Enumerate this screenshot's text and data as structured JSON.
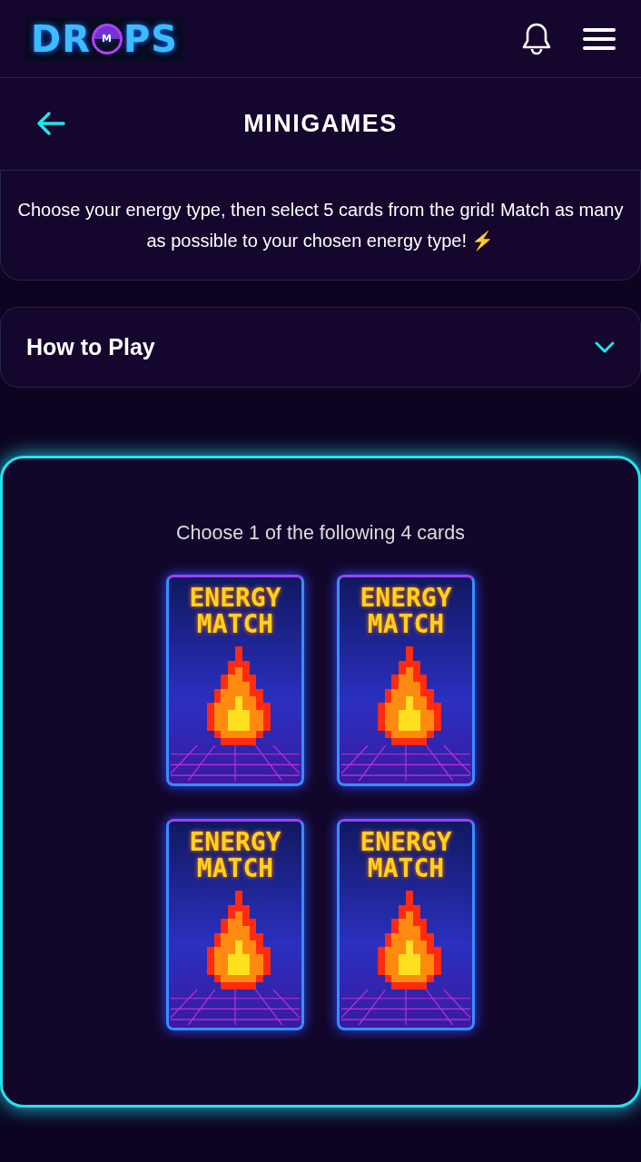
{
  "header": {
    "logo": {
      "text_before": "DR",
      "text_after": "PS",
      "badge_letter": "M"
    }
  },
  "page_title": "MINIGAMES",
  "intro": "Choose your energy type, then select 5 cards from the grid! Match as many as possible to your chosen energy type! ⚡",
  "how_to_play": {
    "title": "How to Play",
    "expanded": false
  },
  "game": {
    "prompt": "Choose 1 of the following 4 cards",
    "cards": [
      {
        "title": "ENERGY MATCH"
      },
      {
        "title": "ENERGY MATCH"
      },
      {
        "title": "ENERGY MATCH"
      },
      {
        "title": "ENERGY MATCH"
      }
    ]
  }
}
